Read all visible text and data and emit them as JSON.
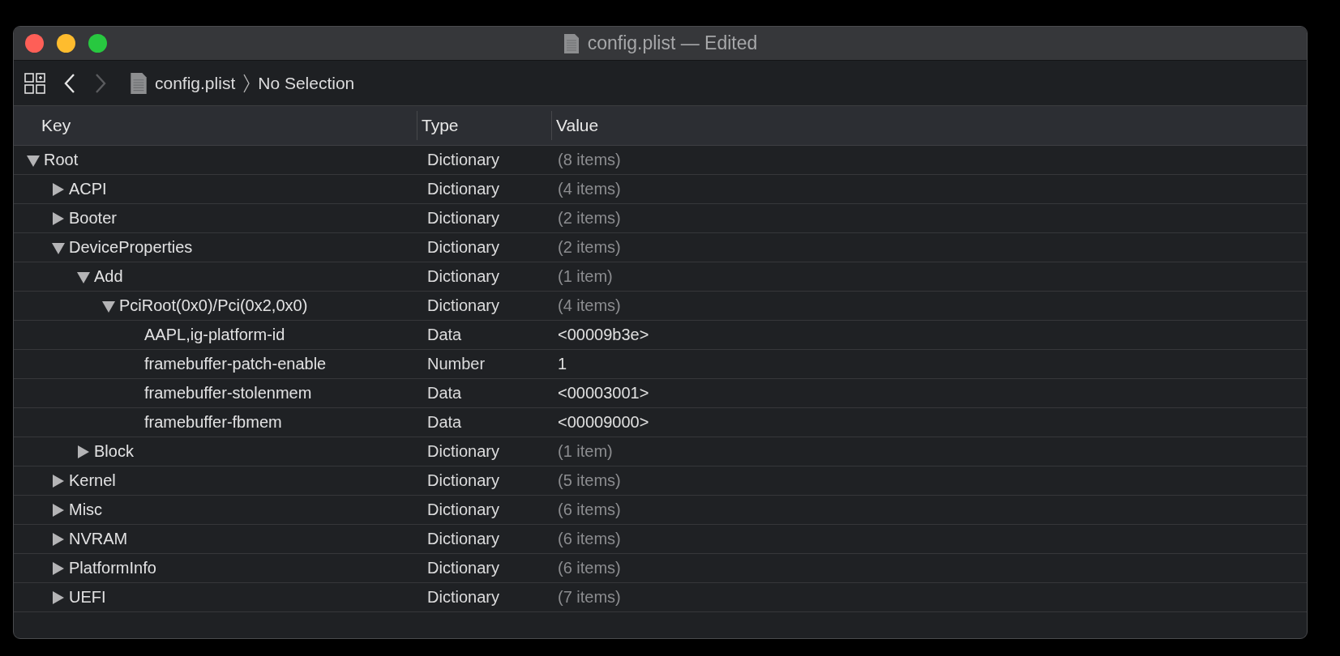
{
  "window": {
    "title": "config.plist — Edited"
  },
  "toolbar": {
    "back_enabled": true,
    "forward_enabled": false,
    "breadcrumb": [
      "config.plist",
      "No Selection"
    ]
  },
  "table": {
    "columns": [
      "Key",
      "Type",
      "Value"
    ],
    "rows": [
      {
        "kind": "container",
        "key": "Root",
        "type": "Dictionary",
        "value": "(8 items)",
        "expanded": true,
        "children": [
          {
            "kind": "container",
            "key": "ACPI",
            "type": "Dictionary",
            "value": "(4 items)",
            "expanded": false
          },
          {
            "kind": "container",
            "key": "Booter",
            "type": "Dictionary",
            "value": "(2 items)",
            "expanded": false
          },
          {
            "kind": "container",
            "key": "DeviceProperties",
            "type": "Dictionary",
            "value": "(2 items)",
            "expanded": true,
            "children": [
              {
                "kind": "container",
                "key": "Add",
                "type": "Dictionary",
                "value": "(1 item)",
                "expanded": true,
                "children": [
                  {
                    "kind": "container",
                    "key": "PciRoot(0x0)/Pci(0x2,0x0)",
                    "type": "Dictionary",
                    "value": "(4 items)",
                    "expanded": true,
                    "children": [
                      {
                        "kind": "leaf",
                        "key": "AAPL,ig-platform-id",
                        "type": "Data",
                        "value": "<00009b3e>"
                      },
                      {
                        "kind": "leaf",
                        "key": "framebuffer-patch-enable",
                        "type": "Number",
                        "value": "1"
                      },
                      {
                        "kind": "leaf",
                        "key": "framebuffer-stolenmem",
                        "type": "Data",
                        "value": "<00003001>"
                      },
                      {
                        "kind": "leaf",
                        "key": "framebuffer-fbmem",
                        "type": "Data",
                        "value": "<00009000>"
                      }
                    ]
                  }
                ]
              },
              {
                "kind": "container",
                "key": "Block",
                "type": "Dictionary",
                "value": "(1 item)",
                "expanded": false
              }
            ]
          },
          {
            "kind": "container",
            "key": "Kernel",
            "type": "Dictionary",
            "value": "(5 items)",
            "expanded": false
          },
          {
            "kind": "container",
            "key": "Misc",
            "type": "Dictionary",
            "value": "(6 items)",
            "expanded": false
          },
          {
            "kind": "container",
            "key": "NVRAM",
            "type": "Dictionary",
            "value": "(6 items)",
            "expanded": false
          },
          {
            "kind": "container",
            "key": "PlatformInfo",
            "type": "Dictionary",
            "value": "(6 items)",
            "expanded": false
          },
          {
            "kind": "container",
            "key": "UEFI",
            "type": "Dictionary",
            "value": "(7 items)",
            "expanded": false
          }
        ]
      }
    ]
  }
}
